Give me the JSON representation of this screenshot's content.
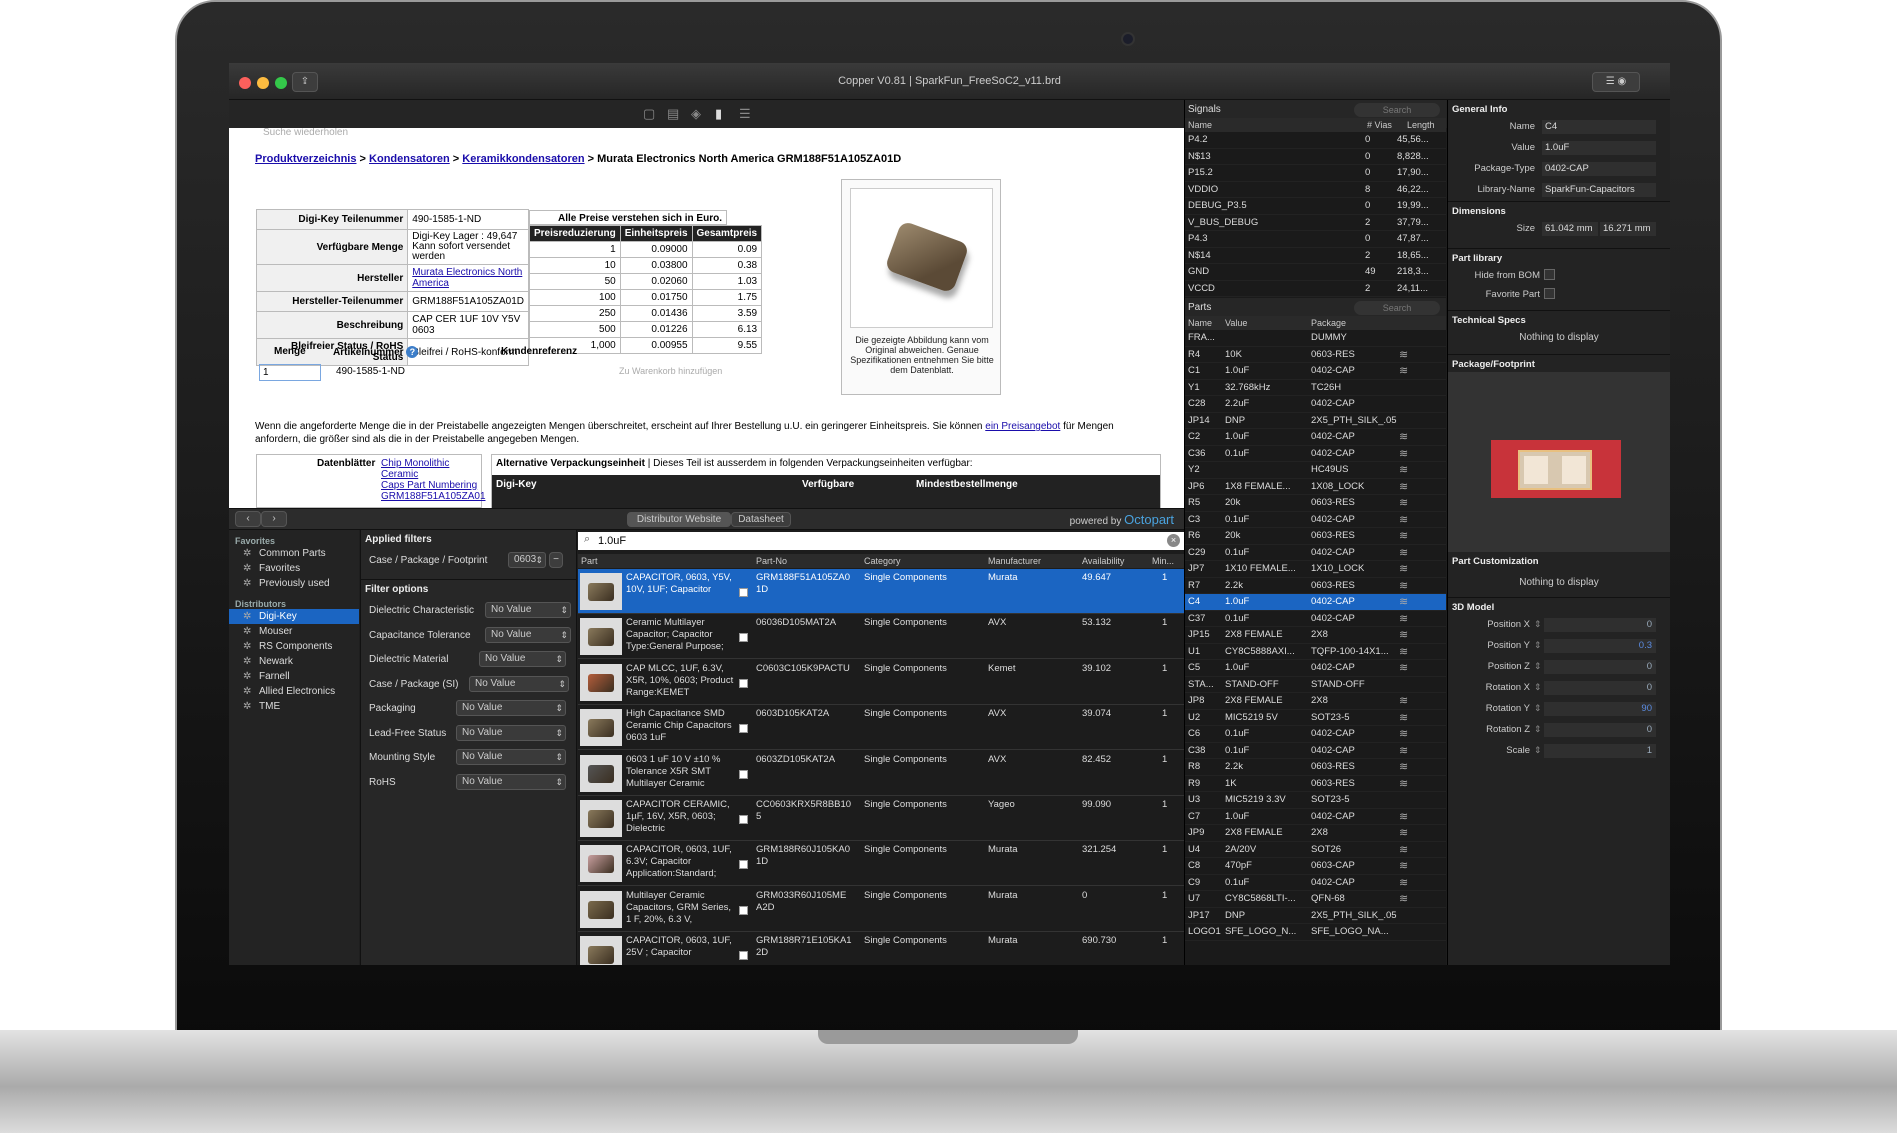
{
  "window": {
    "title": "Copper V0.81 | SparkFun_FreeSoC2_v11.brd"
  },
  "web": {
    "faded_text": "Suche wiederholen",
    "breadcrumb": {
      "c1": "Produktverzeichnis",
      "c2": "Kondensatoren",
      "c3": "Keramikkondensatoren",
      "sep": ">",
      "tail": "> Murata Electronics North America GRM188F51A105ZA01D"
    },
    "info": [
      {
        "k": "Digi-Key Teilenummer",
        "v": "490-1585-1-ND"
      },
      {
        "k": "Verfügbare Menge",
        "v": "Digi-Key Lager : 49,647",
        "v2": "Kann sofort versendet werden"
      },
      {
        "k": "Hersteller",
        "v": "Murata Electronics North America",
        "link": true
      },
      {
        "k": "Hersteller-Teilenummer",
        "v": "GRM188F51A105ZA01D"
      },
      {
        "k": "Beschreibung",
        "v": "CAP CER 1UF 10V Y5V 0603"
      },
      {
        "k": "Bleifreier Status / RoHS Status",
        "v": "Bleifrei / RoHS-konform"
      }
    ],
    "price_note": "Alle Preise verstehen sich in Euro.",
    "price_headers": [
      "Preisreduzierung",
      "Einheitspreis",
      "Gesamtpreis"
    ],
    "prices": [
      [
        "1",
        "0.09000",
        "0.09"
      ],
      [
        "10",
        "0.03800",
        "0.38"
      ],
      [
        "50",
        "0.02060",
        "1.03"
      ],
      [
        "100",
        "0.01750",
        "1.75"
      ],
      [
        "250",
        "0.01436",
        "3.59"
      ],
      [
        "500",
        "0.01226",
        "6.13"
      ],
      [
        "1,000",
        "0.00955",
        "9.55"
      ]
    ],
    "image_caption": "Die gezeigte Abbildung kann vom Original abweichen. Genaue Spezifikationen entnehmen Sie bitte dem Datenblatt.",
    "order": {
      "menge": "Menge",
      "artikel": "Artikelnummer",
      "kunden": "Kundenreferenz",
      "qty": "1",
      "part": "490-1585-1-ND",
      "cart": "Zu Warenkorb hinzufügen"
    },
    "para1": "Wenn die angeforderte Menge die in der Preistabelle angezeigten Mengen überschreitet, erscheint auf Ihrer Bestellung u.U. ein geringerer Einheitspreis. Sie können",
    "para_link": "ein Preisangebot",
    "para2": "für Mengen anfordern, die größer sind als die in der Preistabelle angegeben Mengen.",
    "datenblaetter": "Datenblätter",
    "ds_links": [
      "Chip Monolithic Ceramic",
      "Caps Part Numbering",
      "GRM188F51A105ZA01"
    ],
    "alt_pack": "Alternative Verpackungseinheit",
    "alt_pack_rest": "| Dieses Teil ist ausserdem in folgenden Verpackungseinheiten verfügbar:",
    "alt_cols": [
      "Digi-Key",
      "Verfügbare",
      "Mindestbestellmenge"
    ]
  },
  "browser": {
    "tab1": "Distributor Website",
    "tab2": "Datasheet",
    "powered": "powered by",
    "brand": "Octopart",
    "back": "‹",
    "fwd": "›"
  },
  "sidebar": {
    "fav_title": "Favorites",
    "favorites": [
      "Common Parts",
      "Favorites",
      "Previously used"
    ],
    "dist_title": "Distributors",
    "distributors": [
      "Digi-Key",
      "Mouser",
      "RS Components",
      "Newark",
      "Farnell",
      "Allied Electronics",
      "TME"
    ]
  },
  "filters": {
    "applied_title": "Applied filters",
    "applied": {
      "label": "Case / Package / Footprint",
      "value": "0603"
    },
    "options_title": "Filter options",
    "options": [
      {
        "label": "Dielectric Characteristic",
        "value": "No Value"
      },
      {
        "label": "Capacitance Tolerance",
        "value": "No Value"
      },
      {
        "label": "Dielectric Material",
        "value": "No Value"
      },
      {
        "label": "Case / Package (SI)",
        "value": "No Value"
      },
      {
        "label": "Packaging",
        "value": "No Value"
      },
      {
        "label": "Lead-Free Status",
        "value": "No Value"
      },
      {
        "label": "Mounting Style",
        "value": "No Value"
      },
      {
        "label": "RoHS",
        "value": "No Value"
      }
    ]
  },
  "results": {
    "query": "1.0uF",
    "headers": [
      "Part",
      "Part-No",
      "Category",
      "Manufacturer",
      "Availability",
      "Min..."
    ],
    "rows": [
      {
        "desc": "CAPACITOR, 0603, Y5V, 10V, 1UF; Capacitor",
        "pn": "GRM188F51A105ZA0 1D",
        "cat": "Single Components",
        "mfr": "Murata",
        "avail": "49.647",
        "min": "1"
      },
      {
        "desc": "Ceramic Multilayer Capacitor; Capacitor Type:General Purpose;",
        "pn": "06036D105MAT2A",
        "cat": "Single Components",
        "mfr": "AVX",
        "avail": "53.132",
        "min": "1"
      },
      {
        "desc": "CAP MLCC, 1UF, 6.3V, X5R, 10%, 0603; Product Range:KEMET",
        "pn": "C0603C105K9PACTU",
        "cat": "Single Components",
        "mfr": "Kemet",
        "avail": "39.102",
        "min": "1"
      },
      {
        "desc": "High Capacitance SMD Ceramic Chip Capacitors 0603 1uF",
        "pn": "0603D105KAT2A",
        "cat": "Single Components",
        "mfr": "AVX",
        "avail": "39.074",
        "min": "1"
      },
      {
        "desc": "0603 1 uF 10 V ±10 % Tolerance X5R SMT Multilayer Ceramic",
        "pn": "0603ZD105KAT2A",
        "cat": "Single Components",
        "mfr": "AVX",
        "avail": "82.452",
        "min": "1"
      },
      {
        "desc": "CAPACITOR CERAMIC, 1µF, 16V, X5R, 0603; Dielectric",
        "pn": "CC0603KRX5R8BB10 5",
        "cat": "Single Components",
        "mfr": "Yageo",
        "avail": "99.090",
        "min": "1"
      },
      {
        "desc": "CAPACITOR, 0603, 1UF, 6.3V; Capacitor Application:Standard;",
        "pn": "GRM188R60J105KA0 1D",
        "cat": "Single Components",
        "mfr": "Murata",
        "avail": "321.254",
        "min": "1"
      },
      {
        "desc": "Multilayer Ceramic Capacitors, GRM Series, 1 F, 20%, 6.3 V,",
        "pn": "GRM033R60J105ME A2D",
        "cat": "Single Components",
        "mfr": "Murata",
        "avail": "0",
        "min": "1"
      },
      {
        "desc": "CAPACITOR, 0603, 1UF, 25V ; Capacitor",
        "pn": "GRM188R71E105KA1 2D",
        "cat": "Single Components",
        "mfr": "Murata",
        "avail": "690.730",
        "min": "1"
      }
    ]
  },
  "signals": {
    "title": "Signals",
    "search": "Search",
    "headers": [
      "Name",
      "# Vias",
      "Length"
    ],
    "rows": [
      [
        "P4.2",
        "0",
        "45,56..."
      ],
      [
        "N$13",
        "0",
        "8,828..."
      ],
      [
        "P15.2",
        "0",
        "17,90..."
      ],
      [
        "VDDIO",
        "8",
        "46,22..."
      ],
      [
        "DEBUG_P3.5",
        "0",
        "19,99..."
      ],
      [
        "V_BUS_DEBUG",
        "2",
        "37,79..."
      ],
      [
        "P4.3",
        "0",
        "47,87..."
      ],
      [
        "N$14",
        "2",
        "18,65..."
      ],
      [
        "GND",
        "49",
        "218,3..."
      ],
      [
        "VCCD",
        "2",
        "24,11..."
      ]
    ]
  },
  "parts": {
    "title": "Parts",
    "search": "Search",
    "headers": [
      "Name",
      "Value",
      "Package"
    ],
    "rows": [
      [
        "FRA...",
        "",
        "DUMMY"
      ],
      [
        "R4",
        "10K",
        "0603-RES"
      ],
      [
        "C1",
        "1.0uF",
        "0402-CAP"
      ],
      [
        "Y1",
        "32.768kHz",
        "TC26H"
      ],
      [
        "C28",
        "2.2uF",
        "0402-CAP"
      ],
      [
        "JP14",
        "DNP",
        "2X5_PTH_SILK_.05"
      ],
      [
        "C2",
        "1.0uF",
        "0402-CAP"
      ],
      [
        "C36",
        "0.1uF",
        "0402-CAP"
      ],
      [
        "Y2",
        "",
        "HC49US"
      ],
      [
        "JP6",
        "1X8 FEMALE...",
        "1X08_LOCK"
      ],
      [
        "R5",
        "20k",
        "0603-RES"
      ],
      [
        "C3",
        "0.1uF",
        "0402-CAP"
      ],
      [
        "R6",
        "20k",
        "0603-RES"
      ],
      [
        "C29",
        "0.1uF",
        "0402-CAP"
      ],
      [
        "JP7",
        "1X10 FEMALE...",
        "1X10_LOCK"
      ],
      [
        "R7",
        "2.2k",
        "0603-RES"
      ],
      [
        "C4",
        "1.0uF",
        "0402-CAP"
      ],
      [
        "C37",
        "0.1uF",
        "0402-CAP"
      ],
      [
        "JP15",
        "2X8 FEMALE",
        "2X8"
      ],
      [
        "U1",
        "CY8C5888AXI...",
        "TQFP-100-14X1..."
      ],
      [
        "C5",
        "1.0uF",
        "0402-CAP"
      ],
      [
        "STA...",
        "STAND-OFF",
        "STAND-OFF"
      ],
      [
        "JP8",
        "2X8 FEMALE",
        "2X8"
      ],
      [
        "U2",
        "MIC5219 5V",
        "SOT23-5"
      ],
      [
        "C6",
        "0.1uF",
        "0402-CAP"
      ],
      [
        "C38",
        "0.1uF",
        "0402-CAP"
      ],
      [
        "R8",
        "2.2k",
        "0603-RES"
      ],
      [
        "R9",
        "1K",
        "0603-RES"
      ],
      [
        "U3",
        "MIC5219 3.3V",
        "SOT23-5"
      ],
      [
        "C7",
        "1.0uF",
        "0402-CAP"
      ],
      [
        "JP9",
        "2X8 FEMALE",
        "2X8"
      ],
      [
        "U4",
        "2A/20V",
        "SOT26"
      ],
      [
        "C8",
        "470pF",
        "0603-CAP"
      ],
      [
        "C9",
        "0.1uF",
        "0402-CAP"
      ],
      [
        "U7",
        "CY8C5868LTI-...",
        "QFN-68"
      ],
      [
        "JP17",
        "DNP",
        "2X5_PTH_SILK_.05"
      ],
      [
        "LOGO1",
        "SFE_LOGO_N...",
        "SFE_LOGO_NA..."
      ]
    ],
    "selected": "C4"
  },
  "inspector": {
    "general_title": "General Info",
    "general": [
      {
        "k": "Name",
        "v": "C4"
      },
      {
        "k": "Value",
        "v": "1.0uF"
      },
      {
        "k": "Package-Type",
        "v": "0402-CAP"
      },
      {
        "k": "Library-Name",
        "v": "SparkFun-Capacitors"
      }
    ],
    "dim_title": "Dimensions",
    "size_label": "Size",
    "size_w": "61.042 mm",
    "size_h": "16.271 mm",
    "lib_title": "Part library",
    "hide_bom": "Hide from BOM",
    "favorite": "Favorite Part",
    "tech_title": "Technical Specs",
    "nothing": "Nothing to display",
    "pkg_title": "Package/Footprint",
    "cust_title": "Part Customization",
    "nothing2": "Nothing to display",
    "model_title": "3D Model",
    "model": [
      {
        "k": "Position X",
        "v": "0"
      },
      {
        "k": "Position Y",
        "v": "0.3"
      },
      {
        "k": "Position Z",
        "v": "0"
      },
      {
        "k": "Rotation X",
        "v": "0"
      },
      {
        "k": "Rotation Y",
        "v": "90"
      },
      {
        "k": "Rotation Z",
        "v": "0"
      },
      {
        "k": "Scale",
        "v": "1"
      }
    ]
  },
  "colors": {
    "accent": "#1b65c2",
    "footprint": "#c8333a",
    "pad": "#e8d8c0"
  }
}
